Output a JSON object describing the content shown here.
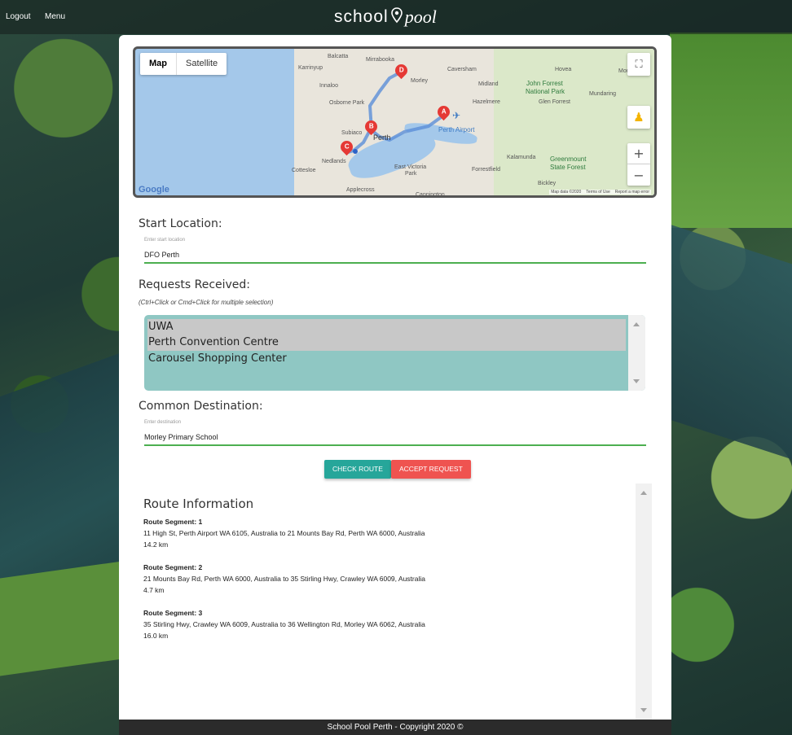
{
  "topbar": {
    "logout_label": "Logout",
    "menu_label": "Menu",
    "logo_school": "school",
    "logo_pool": "pool"
  },
  "map": {
    "type_map": "Map",
    "type_satellite": "Satellite",
    "google_logo": "Google",
    "map_data": "Map data ©2020",
    "terms": "Terms of Use",
    "report": "Report a map error",
    "places": {
      "balcatta": "Balcatta",
      "mirrabooka": "Mirrabooka",
      "karrinyup": "Karrinyup",
      "caversham": "Caversham",
      "hovea": "Hovea",
      "mount_helena": "Mount Hele",
      "innaloo": "Innaloo",
      "morley": "Morley",
      "midland": "Midland",
      "john_forrest": "John Forrest",
      "national_park": "National Park",
      "mundaring": "Mundaring",
      "osborne_park": "Osborne Park",
      "hazelmere": "Hazelmere",
      "glen_forrest": "Glen Forrest",
      "subiaco": "Subiaco",
      "perth": "Perth",
      "perth_airport": "Perth Airport",
      "nedlands": "Nedlands",
      "cottesloe": "Cottesloe",
      "east_victoria_park": "East Victoria",
      "park": "Park",
      "kalamunda": "Kalamunda",
      "forrestfield": "Forrestfield",
      "greenmount": "Greenmount",
      "state_forest": "State Forest",
      "bickley": "Bickley",
      "applecross": "Applecross",
      "cannington": "Cannington"
    },
    "markers": [
      "A",
      "B",
      "C",
      "D"
    ]
  },
  "form": {
    "start_heading": "Start Location:",
    "start_hint": "Enter start location",
    "start_value": "DFO Perth",
    "requests_heading": "Requests Received:",
    "requests_hint": "(Ctrl+Click or Cmd+Click for multiple selection)",
    "requests": [
      {
        "label": "UWA",
        "selected": true
      },
      {
        "label": "Perth Convention Centre",
        "selected": true
      },
      {
        "label": "Carousel Shopping Center",
        "selected": false
      }
    ],
    "destination_heading": "Common Destination:",
    "destination_hint": "Enter destination",
    "destination_value": "Morley Primary School",
    "check_route_label": "Check Route",
    "accept_request_label": "Accept Request"
  },
  "route_info": {
    "title": "Route Information",
    "segments": [
      {
        "heading": "Route Segment: 1",
        "path": "11 High St, Perth Airport WA 6105, Australia to 21 Mounts Bay Rd, Perth WA 6000, Australia",
        "distance": "14.2 km"
      },
      {
        "heading": "Route Segment: 2",
        "path": "21 Mounts Bay Rd, Perth WA 6000, Australia to 35 Stirling Hwy, Crawley WA 6009, Australia",
        "distance": "4.7 km"
      },
      {
        "heading": "Route Segment: 3",
        "path": "35 Stirling Hwy, Crawley WA 6009, Australia to 36 Wellington Rd, Morley WA 6062, Australia",
        "distance": "16.0 km"
      }
    ]
  },
  "footer": {
    "text": "School Pool Perth - Copyright 2020 ©"
  },
  "colors": {
    "teal_button": "#26a69a",
    "red_button": "#ef5350",
    "input_underline": "#4caf50",
    "list_background": "#8fc7c3",
    "marker_red": "#e53935"
  }
}
